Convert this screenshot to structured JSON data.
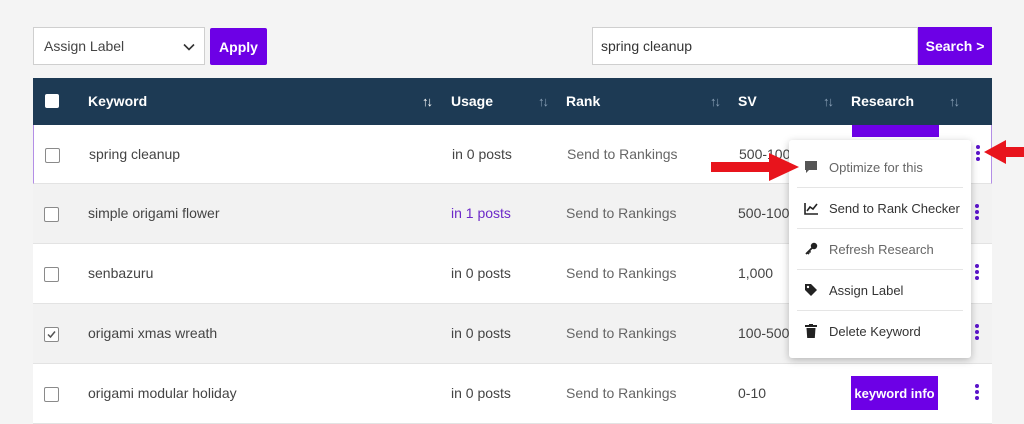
{
  "toolbar": {
    "label_select": "Assign Label",
    "apply_label": "Apply",
    "search_value": "spring cleanup",
    "search_label": "Search >"
  },
  "columns": [
    "Keyword",
    "Usage",
    "Rank",
    "SV",
    "Research"
  ],
  "rows": [
    {
      "keyword": "spring cleanup",
      "usage": "in 0 posts",
      "rank": "Send to Rankings",
      "sv": "500-1000",
      "checked": false
    },
    {
      "keyword": "simple origami flower",
      "usage": "in 1 posts",
      "rank": "Send to Rankings",
      "sv": "500-1000",
      "checked": false
    },
    {
      "keyword": "senbazuru",
      "usage": "in 0 posts",
      "rank": "Send to Rankings",
      "sv": "1,000",
      "checked": false
    },
    {
      "keyword": "origami xmas wreath",
      "usage": "in 0 posts",
      "rank": "Send to Rankings",
      "sv": "100-500",
      "checked": true
    },
    {
      "keyword": "origami modular holiday",
      "usage": "in 0 posts",
      "rank": "Send to Rankings",
      "sv": "0-10",
      "checked": false
    }
  ],
  "research_button": "keyword info",
  "menu": {
    "items": [
      {
        "label": "Optimize for this",
        "icon": "comment-icon"
      },
      {
        "label": "Send to Rank Checker",
        "icon": "line-chart-icon"
      },
      {
        "label": "Refresh Research",
        "icon": "key-icon"
      },
      {
        "label": "Assign Label",
        "icon": "tag-icon"
      },
      {
        "label": "Delete Keyword",
        "icon": "trash-icon"
      }
    ]
  },
  "colors": {
    "accent": "#6d00e6",
    "header": "#1d3a54",
    "annotation_arrow": "#e8141c"
  }
}
